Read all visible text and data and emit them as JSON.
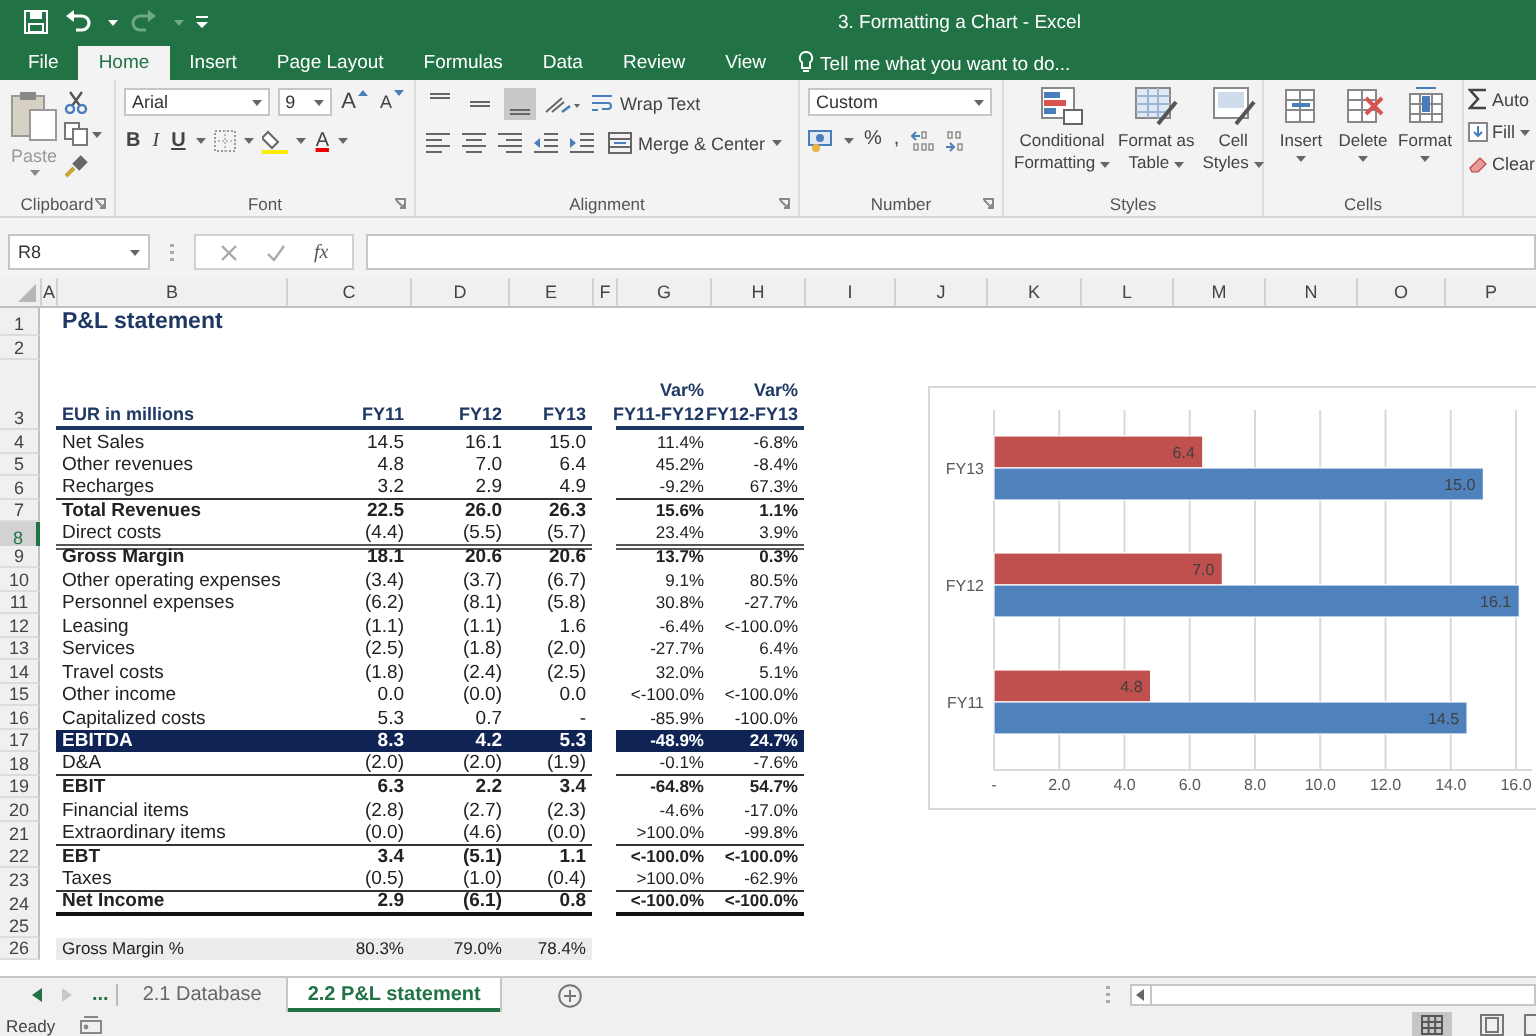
{
  "window": {
    "title": "3. Formatting a Chart - Excel"
  },
  "ribbon_tabs": [
    {
      "label": "File",
      "selected": false
    },
    {
      "label": "Home",
      "selected": true
    },
    {
      "label": "Insert",
      "selected": false
    },
    {
      "label": "Page Layout",
      "selected": false
    },
    {
      "label": "Formulas",
      "selected": false
    },
    {
      "label": "Data",
      "selected": false
    },
    {
      "label": "Review",
      "selected": false
    },
    {
      "label": "View",
      "selected": false
    }
  ],
  "tell_me": {
    "placeholder": "Tell me what you want to do..."
  },
  "ribbon": {
    "clipboard": {
      "paste": "Paste",
      "group": "Clipboard"
    },
    "font": {
      "font_name": "Arial",
      "font_size": "9",
      "grow": "A",
      "shrink": "A",
      "bold": "B",
      "italic": "I",
      "underline": "U",
      "font_color": "A",
      "group": "Font"
    },
    "alignment": {
      "vertical_align": [
        {
          "kind": "top",
          "selected": false
        },
        {
          "kind": "middle",
          "selected": false
        },
        {
          "kind": "bottom",
          "selected": true
        }
      ],
      "wrap_text": "Wrap Text",
      "merge_center": "Merge & Center",
      "group": "Alignment"
    },
    "number": {
      "format": "Custom",
      "percent": "%",
      "comma": ",",
      "group": "Number"
    },
    "styles": {
      "buttons": [
        {
          "lines": [
            "Conditional",
            "Formatting"
          ],
          "kind": "conditional"
        },
        {
          "lines": [
            "Format as",
            "Table"
          ],
          "kind": "table"
        },
        {
          "lines": [
            "Cell",
            "Styles"
          ],
          "kind": "cell"
        }
      ],
      "group": "Styles"
    },
    "cells": {
      "buttons": [
        {
          "label": "Insert",
          "kind": "insert"
        },
        {
          "label": "Delete",
          "kind": "delete"
        },
        {
          "label": "Format",
          "kind": "format"
        }
      ],
      "group": "Cells"
    },
    "editing": {
      "autosum": "Auto",
      "fill": "Fill",
      "clear": "Clear"
    }
  },
  "formula_bar": {
    "name_box": "R8",
    "function_label": "fx"
  },
  "sheet": {
    "columns": [
      "A",
      "B",
      "C",
      "D",
      "E",
      "F",
      "G",
      "H",
      "I",
      "J",
      "K",
      "L",
      "M",
      "N",
      "O",
      "P"
    ],
    "rows": [
      {
        "number": "1",
        "kind": "title",
        "label": "P&L statement",
        "selected": false
      },
      {
        "number": "2",
        "kind": "empty",
        "selected": false
      },
      {
        "number": "3",
        "kind": "header",
        "label": "EUR in millions",
        "values": [
          "FY11",
          "FY12",
          "FY13"
        ],
        "var_heads": [
          [
            "Var%",
            "FY11-FY12"
          ],
          [
            "Var%",
            "FY12-FY13"
          ]
        ],
        "selected": false
      },
      {
        "number": "4",
        "kind": "normal",
        "label": "Net Sales",
        "values": [
          "14.5",
          "16.1",
          "15.0"
        ],
        "variances": [
          "11.4%",
          "-6.8%"
        ],
        "selected": false
      },
      {
        "number": "5",
        "kind": "normal",
        "label": "Other revenues",
        "values": [
          "4.8",
          "7.0",
          "6.4"
        ],
        "variances": [
          "45.2%",
          "-8.4%"
        ],
        "selected": false
      },
      {
        "number": "6",
        "kind": "normal",
        "label": "Recharges",
        "values": [
          "3.2",
          "2.9",
          "4.9"
        ],
        "variances": [
          "-9.2%",
          "67.3%"
        ],
        "rule": {
          "kind": "single"
        },
        "selected": false
      },
      {
        "number": "7",
        "kind": "bold",
        "label": "Total Revenues",
        "values": [
          "22.5",
          "26.0",
          "26.3"
        ],
        "variances": [
          "15.6%",
          "1.1%"
        ],
        "selected": false
      },
      {
        "number": "8",
        "kind": "normal",
        "label": "Direct costs",
        "values": [
          "(4.4)",
          "(5.5)",
          "(5.7)"
        ],
        "variances": [
          "23.4%",
          "3.9%"
        ],
        "rule": {
          "kind": "double"
        },
        "selected": true
      },
      {
        "number": "9",
        "kind": "bold",
        "label": "Gross Margin",
        "values": [
          "18.1",
          "20.6",
          "20.6"
        ],
        "variances": [
          "13.7%",
          "0.3%"
        ],
        "selected": false
      },
      {
        "number": "10",
        "kind": "normal",
        "label": "Other operating expenses",
        "values": [
          "(3.4)",
          "(3.7)",
          "(6.7)"
        ],
        "variances": [
          "9.1%",
          "80.5%"
        ],
        "selected": false
      },
      {
        "number": "11",
        "kind": "normal",
        "label": "Personnel expenses",
        "values": [
          "(6.2)",
          "(8.1)",
          "(5.8)"
        ],
        "variances": [
          "30.8%",
          "-27.7%"
        ],
        "selected": false
      },
      {
        "number": "12",
        "kind": "normal",
        "label": "Leasing",
        "values": [
          "(1.1)",
          "(1.1)",
          "1.6"
        ],
        "variances": [
          "-6.4%",
          "<-100.0%"
        ],
        "selected": false
      },
      {
        "number": "13",
        "kind": "normal",
        "label": "Services",
        "values": [
          "(2.5)",
          "(1.8)",
          "(2.0)"
        ],
        "variances": [
          "-27.7%",
          "6.4%"
        ],
        "selected": false
      },
      {
        "number": "14",
        "kind": "normal",
        "label": "Travel costs",
        "values": [
          "(1.8)",
          "(2.4)",
          "(2.5)"
        ],
        "variances": [
          "32.0%",
          "5.1%"
        ],
        "selected": false
      },
      {
        "number": "15",
        "kind": "normal",
        "label": "Other income",
        "values": [
          "0.0",
          "(0.0)",
          "0.0"
        ],
        "variances": [
          "<-100.0%",
          "<-100.0%"
        ],
        "selected": false
      },
      {
        "number": "16",
        "kind": "normal",
        "label": "Capitalized costs",
        "values": [
          "5.3",
          "0.7",
          "-"
        ],
        "variances": [
          "-85.9%",
          "-100.0%"
        ],
        "selected": false
      },
      {
        "number": "17",
        "kind": "highlight",
        "label": "EBITDA",
        "values": [
          "8.3",
          "4.2",
          "5.3"
        ],
        "variances": [
          "-48.9%",
          "24.7%"
        ],
        "selected": false
      },
      {
        "number": "18",
        "kind": "normal",
        "label": "D&A",
        "values": [
          "(2.0)",
          "(2.0)",
          "(1.9)"
        ],
        "variances": [
          "-0.1%",
          "-7.6%"
        ],
        "rule": {
          "kind": "single"
        },
        "selected": false
      },
      {
        "number": "19",
        "kind": "bold",
        "label": "EBIT",
        "values": [
          "6.3",
          "2.2",
          "3.4"
        ],
        "variances": [
          "-64.8%",
          "54.7%"
        ],
        "selected": false
      },
      {
        "number": "20",
        "kind": "normal",
        "label": "Financial items",
        "values": [
          "(2.8)",
          "(2.7)",
          "(2.3)"
        ],
        "variances": [
          "-4.6%",
          "-17.0%"
        ],
        "selected": false
      },
      {
        "number": "21",
        "kind": "normal",
        "label": "Extraordinary items",
        "values": [
          "(0.0)",
          "(4.6)",
          "(0.0)"
        ],
        "variances": [
          ">100.0%",
          "-99.8%"
        ],
        "rule": {
          "kind": "single"
        },
        "selected": false
      },
      {
        "number": "22",
        "kind": "bold",
        "label": "EBT",
        "values": [
          "3.4",
          "(5.1)",
          "1.1"
        ],
        "variances": [
          "<-100.0%",
          "<-100.0%"
        ],
        "selected": false
      },
      {
        "number": "23",
        "kind": "normal",
        "label": "Taxes",
        "values": [
          "(0.5)",
          "(1.0)",
          "(0.4)"
        ],
        "variances": [
          ">100.0%",
          "-62.9%"
        ],
        "rule": {
          "kind": "single"
        },
        "selected": false
      },
      {
        "number": "24",
        "kind": "bold",
        "label": "Net Income",
        "values": [
          "2.9",
          "(6.1)",
          "0.8"
        ],
        "variances": [
          "<-100.0%",
          "<-100.0%"
        ],
        "rule": {
          "kind": "thick"
        },
        "selected": false
      },
      {
        "number": "25",
        "kind": "empty",
        "selected": false
      },
      {
        "number": "26",
        "kind": "shaded",
        "label": "Gross Margin %",
        "values": [
          "80.3%",
          "79.0%",
          "78.4%"
        ],
        "selected": false
      }
    ]
  },
  "chart": {
    "chart_data": {
      "type": "bar",
      "orientation": "horizontal",
      "categories": [
        "FY13",
        "FY12",
        "FY11"
      ],
      "series": [
        {
          "color": "#c0504d",
          "values": [
            6.4,
            7.0,
            4.8
          ],
          "value_labels": [
            "6.4",
            "7.0",
            "4.8"
          ]
        },
        {
          "color": "#4f81bd",
          "values": [
            15.0,
            16.1,
            14.5
          ],
          "value_labels": [
            "15.0",
            "16.1",
            "14.5"
          ]
        }
      ],
      "xlim": [
        0,
        16.5
      ],
      "grid": true,
      "xticks": [
        {
          "value": 0,
          "label": "-"
        },
        {
          "value": 2,
          "label": "2.0"
        },
        {
          "value": 4,
          "label": "4.0"
        },
        {
          "value": 6,
          "label": "6.0"
        },
        {
          "value": 8,
          "label": "8.0"
        },
        {
          "value": 10,
          "label": "10.0"
        },
        {
          "value": 12,
          "label": "12.0"
        },
        {
          "value": 14,
          "label": "14.0"
        },
        {
          "value": 16,
          "label": "16.0"
        }
      ]
    }
  },
  "sheet_tabs": {
    "more": "...",
    "tabs": [
      {
        "label": "2.1 Database",
        "selected": false
      },
      {
        "label": "2.2 P&L statement",
        "selected": true
      }
    ]
  },
  "status_bar": {
    "status": "Ready"
  }
}
